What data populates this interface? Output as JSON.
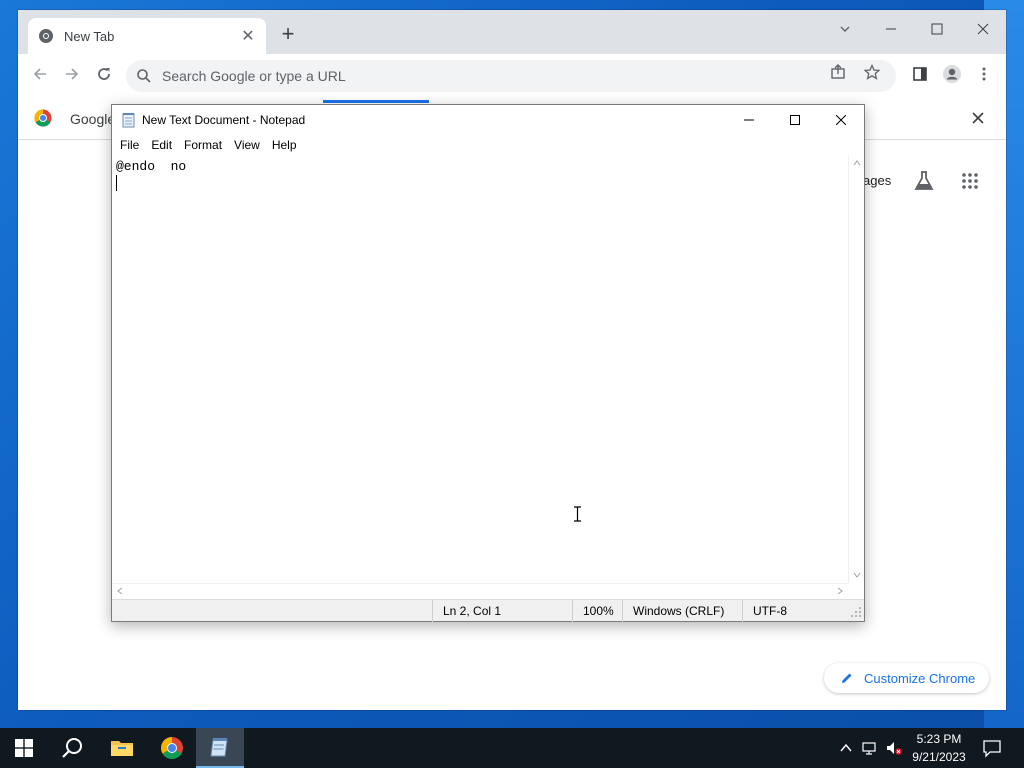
{
  "chrome": {
    "tab_title": "New Tab",
    "tab_close": "✕",
    "new_tab": "+",
    "omnibox_placeholder": "Search Google or type a URL",
    "bookmark_text": "Google",
    "images_link": "ages",
    "customize_label": "Customize Chrome",
    "accent": "#1a73e8"
  },
  "notepad": {
    "title": "New Text Document - Notepad",
    "menu": [
      "File",
      "Edit",
      "Format",
      "View",
      "Help"
    ],
    "content": "@endo  no",
    "status": {
      "position": "Ln 2, Col 1",
      "zoom": "100%",
      "line_ending": "Windows (CRLF)",
      "encoding": "UTF-8"
    }
  },
  "taskbar": {
    "time": "5:23 PM",
    "date": "9/21/2023"
  }
}
